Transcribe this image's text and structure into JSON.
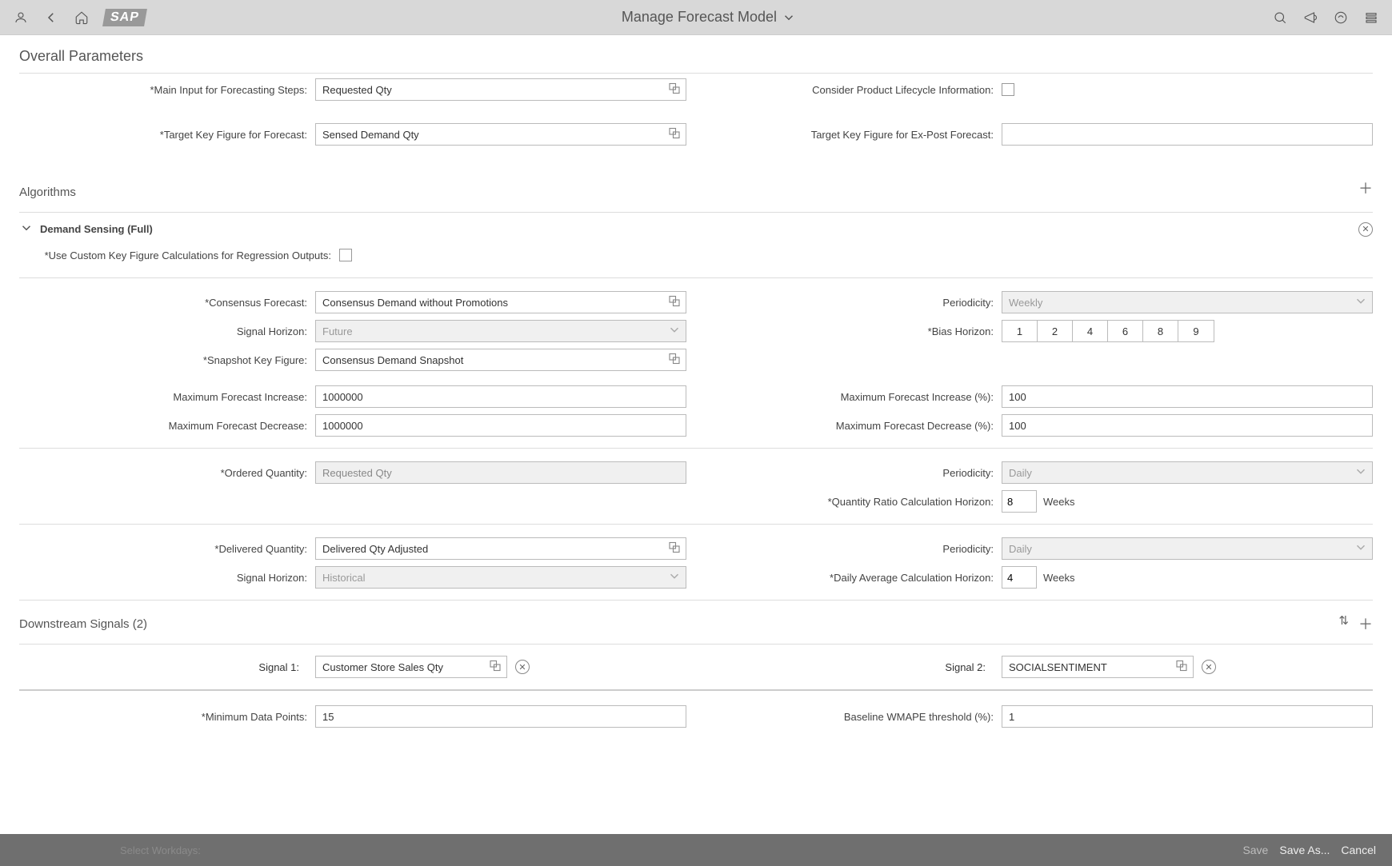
{
  "header": {
    "title": "Manage Forecast Model",
    "logo": "SAP"
  },
  "sections": {
    "overall_params_title": "Overall Parameters",
    "algorithms_title": "Algorithms",
    "algo_name": "Demand Sensing (Full)",
    "downstream_title": "Downstream Signals (2)"
  },
  "labels": {
    "main_input": "Main Input for Forecasting Steps:",
    "consider_lifecycle": "Consider Product Lifecycle Information:",
    "target_kf": "Target Key Figure for Forecast:",
    "target_kf_expost": "Target Key Figure for Ex-Post Forecast:",
    "use_custom_kf": "Use Custom Key Figure Calculations for Regression Outputs:",
    "consensus_forecast": "Consensus Forecast:",
    "periodicity": "Periodicity:",
    "signal_horizon": "Signal Horizon:",
    "bias_horizon": "Bias Horizon:",
    "snapshot_kf": "Snapshot Key Figure:",
    "max_increase": "Maximum Forecast Increase:",
    "max_increase_pct": "Maximum Forecast Increase (%):",
    "max_decrease": "Maximum Forecast Decrease:",
    "max_decrease_pct": "Maximum Forecast Decrease (%):",
    "ordered_qty": "Ordered Quantity:",
    "qty_ratio_horizon": "Quantity Ratio Calculation Horizon:",
    "delivered_qty": "Delivered Quantity:",
    "daily_avg_horizon": "Daily Average Calculation Horizon:",
    "signal1": "Signal 1:",
    "signal2": "Signal 2:",
    "min_data_points": "Minimum Data Points:",
    "baseline_wmape": "Baseline WMAPE threshold (%):",
    "weeks_unit": "Weeks"
  },
  "values": {
    "main_input": "Requested Qty",
    "target_kf": "Sensed Demand Qty",
    "target_kf_expost": "",
    "consensus_forecast": "Consensus Demand without Promotions",
    "periodicity_weekly": "Weekly",
    "signal_horizon_future": "Future",
    "signal_horizon_hist": "Historical",
    "snapshot_kf": "Consensus Demand Snapshot",
    "max_increase": "1000000",
    "max_increase_pct": "100",
    "max_decrease": "1000000",
    "max_decrease_pct": "100",
    "ordered_qty": "Requested Qty",
    "periodicity_daily": "Daily",
    "qty_ratio_horizon": "8",
    "delivered_qty": "Delivered Qty Adjusted",
    "daily_avg_horizon": "4",
    "signal1": "Customer Store Sales Qty",
    "signal2": "SOCIALSENTIMENT",
    "min_data_points": "15",
    "baseline_wmape": "1"
  },
  "bias_horizon": [
    "1",
    "2",
    "4",
    "6",
    "8",
    "9"
  ],
  "footer": {
    "ghost": "Select Workdays:",
    "save": "Save",
    "save_as": "Save As...",
    "cancel": "Cancel"
  }
}
